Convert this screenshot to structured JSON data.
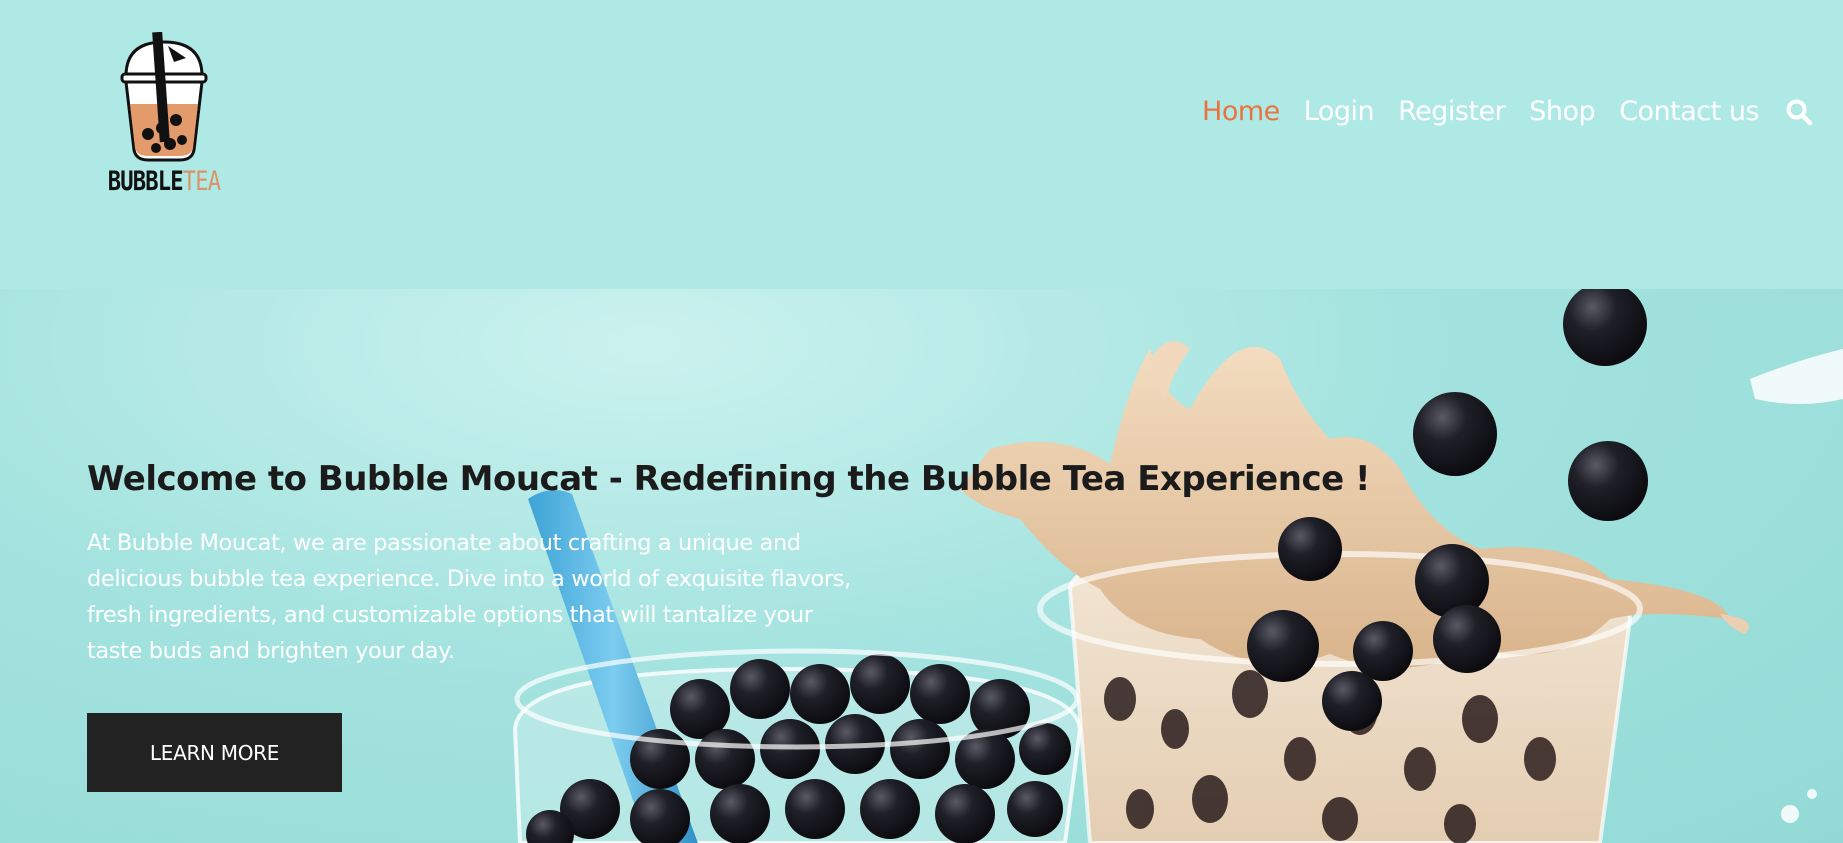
{
  "brand": {
    "word1": "BUBBLE",
    "word2": "TEA"
  },
  "nav": {
    "items": [
      {
        "label": "Home",
        "active": true
      },
      {
        "label": "Login",
        "active": false
      },
      {
        "label": "Register",
        "active": false
      },
      {
        "label": "Shop",
        "active": false
      },
      {
        "label": "Contact us",
        "active": false
      }
    ],
    "search_icon": "search-icon"
  },
  "hero": {
    "title": "Welcome to Bubble Moucat - Redefining the Bubble Tea Experience !",
    "text_lines": [
      "At Bubble Moucat, we are passionate about crafting a unique and",
      "delicious bubble tea experience. Dive into a world of exquisite flavors,",
      "fresh ingredients, and customizable options that will tantalize your",
      "taste buds and brighten your day."
    ],
    "button_label": "LEARN MORE"
  },
  "colors": {
    "background": "#afe9e5",
    "nav_active": "#e8733f",
    "nav_text": "#ffffff",
    "button_bg": "#222222",
    "brand_accent": "#d9946a"
  }
}
